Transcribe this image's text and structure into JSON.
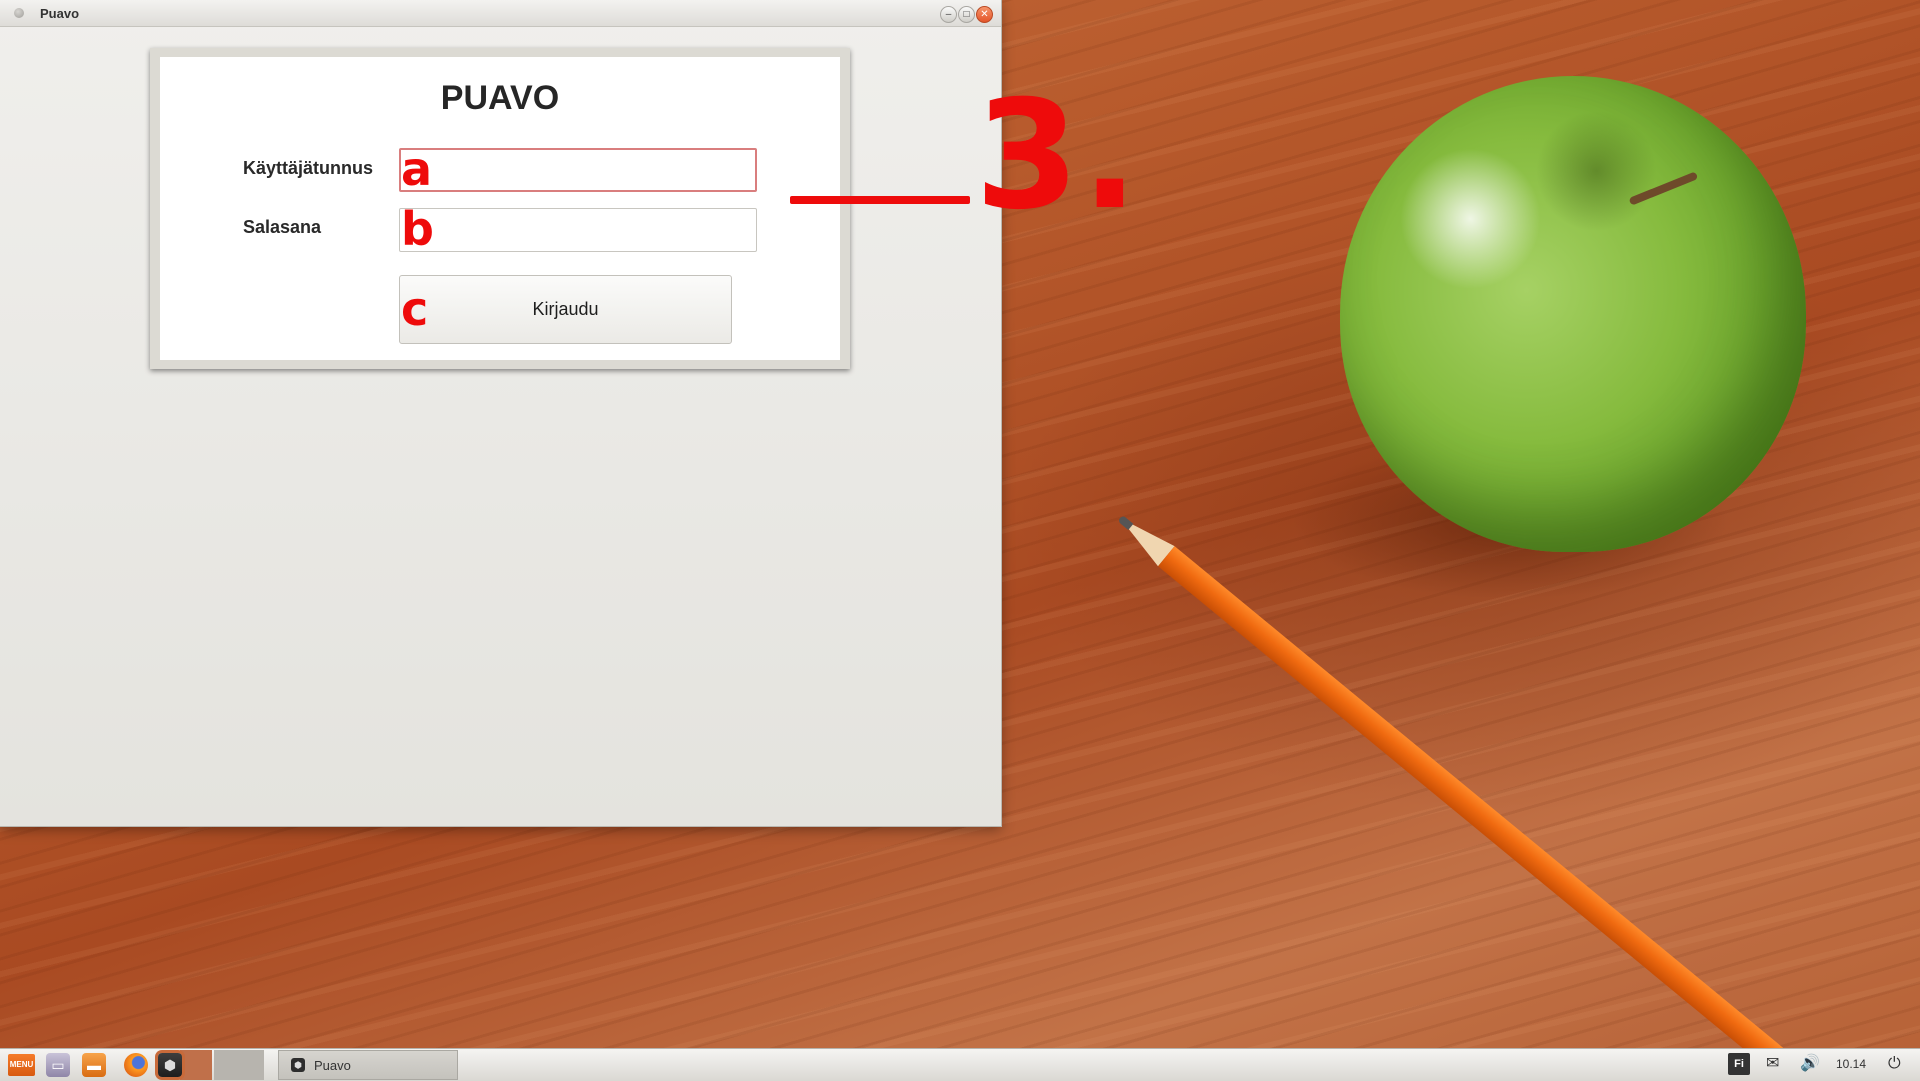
{
  "window": {
    "title": "Puavo",
    "minimize_glyph": "–",
    "maximize_glyph": "□",
    "close_glyph": "✕"
  },
  "login": {
    "heading": "PUAVO",
    "username_label": "Käyttäjätunnus",
    "username_value": "",
    "password_label": "Salasana",
    "password_value": "",
    "submit_label": "Kirjaudu"
  },
  "annotations": {
    "a": "a",
    "b": "b",
    "c": "c",
    "step": "3.",
    "color": "#ee0b0b"
  },
  "taskbar": {
    "menu_label": "MENU",
    "launchers": [
      "desktop-icon",
      "files-icon",
      "firefox-icon",
      "puavo-icon"
    ],
    "task_label": "Puavo",
    "keyboard_layout": "Fi",
    "clock": "10.14",
    "tray_icons": [
      "mail-icon",
      "volume-icon",
      "power-icon"
    ]
  },
  "colors": {
    "accent_orange": "#e4552a",
    "annotation_red": "#ee0b0b"
  }
}
